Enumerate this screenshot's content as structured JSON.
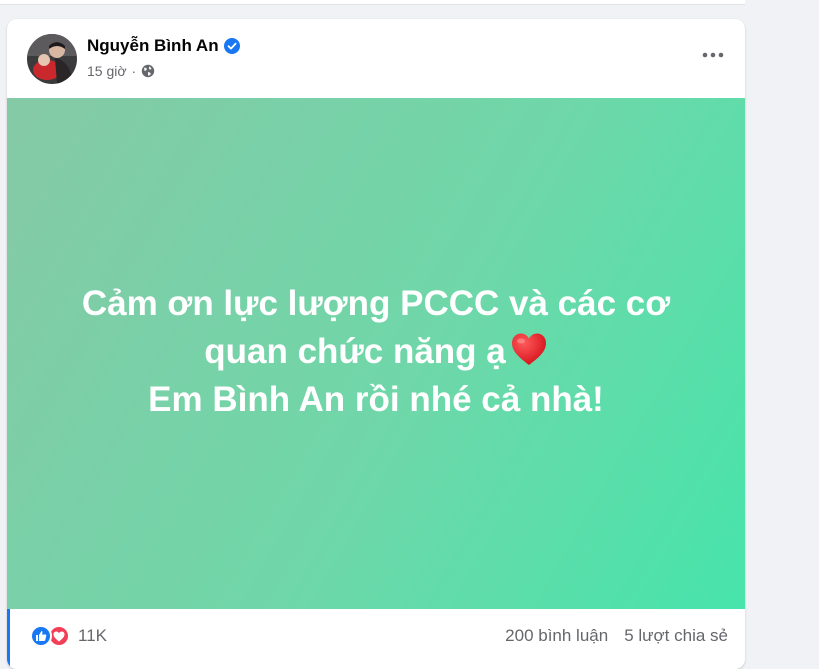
{
  "post": {
    "author": "Nguyễn Bình An",
    "time": "15 giờ",
    "audience_icon": "globe-icon",
    "verified_icon": "verified-badge-icon",
    "text_line1": "Cảm ơn lực lượng PCCC và các cơ",
    "text_line2": "quan chức năng ạ",
    "text_line3": "Em Bình An rồi nhé cả nhà!",
    "emoji": "red-heart",
    "background_gradient": [
      "#85c9a6",
      "#47e4ab"
    ]
  },
  "footer": {
    "reaction_count": "11K",
    "comments": "200 bình luận",
    "shares": "5 lượt chia sẻ"
  },
  "colors": {
    "accent": "#1877f2",
    "love": "#f33e58",
    "secondary_text": "#65676b"
  }
}
